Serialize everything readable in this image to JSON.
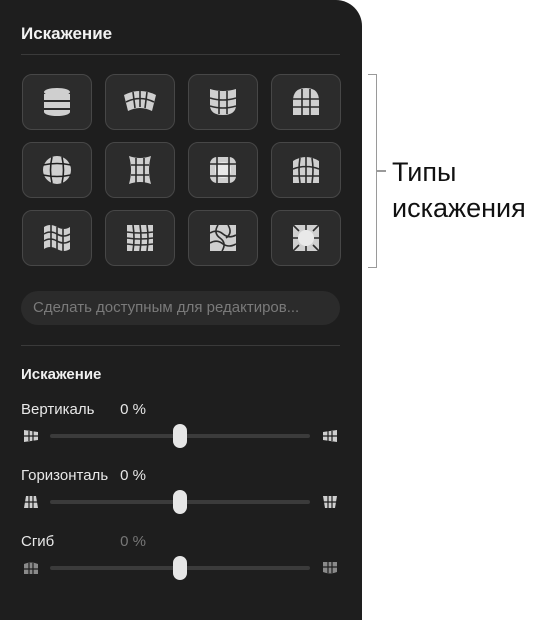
{
  "panel": {
    "title": "Искажение"
  },
  "distortion_types": [
    {
      "name": "cylinder"
    },
    {
      "name": "arch"
    },
    {
      "name": "cup"
    },
    {
      "name": "dome"
    },
    {
      "name": "sphere"
    },
    {
      "name": "pinch"
    },
    {
      "name": "bulge"
    },
    {
      "name": "shell"
    },
    {
      "name": "flag"
    },
    {
      "name": "wave"
    },
    {
      "name": "twist"
    },
    {
      "name": "inflate"
    }
  ],
  "custom_field": {
    "placeholder": "Сделать доступным для редактиров..."
  },
  "section": {
    "title": "Искажение"
  },
  "sliders": [
    {
      "label": "Вертикаль",
      "value": "0 %",
      "level": 0.5,
      "dim": false
    },
    {
      "label": "Горизонталь",
      "value": "0 %",
      "level": 0.5,
      "dim": false
    },
    {
      "label": "Сгиб",
      "value": "0 %",
      "level": 0.5,
      "dim": true
    }
  ],
  "callout": {
    "line1": "Типы",
    "line2": "искажения"
  },
  "colors": {
    "panel": "#1e1e1e",
    "tile": "#2c2c2c",
    "icon": "#cfcfcf",
    "thumb": "#e6e6e6"
  }
}
